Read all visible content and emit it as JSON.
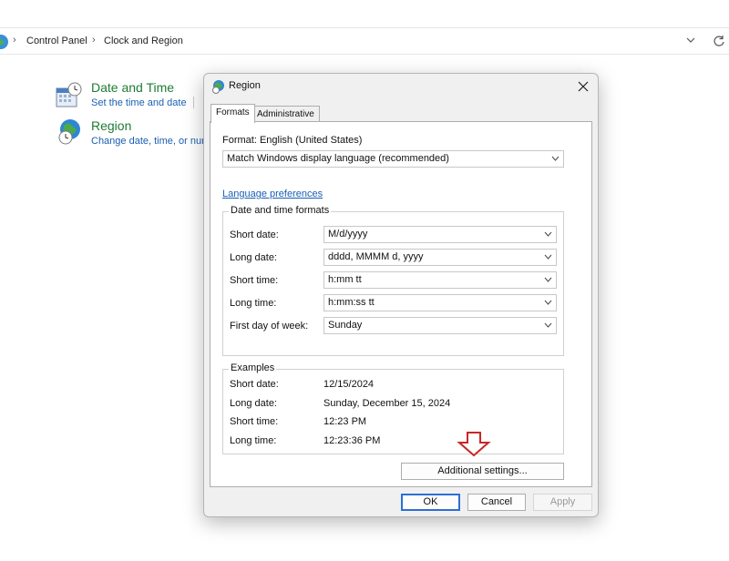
{
  "explorer": {
    "breadcrumb": [
      "Control Panel",
      "Clock and Region"
    ]
  },
  "control_panel": {
    "items": [
      {
        "title": "Date and Time",
        "link": "Set the time and date",
        "icon": "calendar-clock-icon"
      },
      {
        "title": "Region",
        "link": "Change date, time, or nun",
        "icon": "globe-clock-icon"
      }
    ]
  },
  "dialog": {
    "title": "Region",
    "tabs": [
      "Formats",
      "Administrative"
    ],
    "format_label": "Format: English (United States)",
    "format_value": "Match Windows display language (recommended)",
    "language_link": "Language preferences",
    "date_time_group": {
      "legend": "Date and time formats",
      "rows": [
        {
          "label": "Short date:",
          "value": "M/d/yyyy"
        },
        {
          "label": "Long date:",
          "value": "dddd, MMMM d, yyyy"
        },
        {
          "label": "Short time:",
          "value": "h:mm tt"
        },
        {
          "label": "Long time:",
          "value": "h:mm:ss tt"
        },
        {
          "label": "First day of week:",
          "value": "Sunday"
        }
      ]
    },
    "examples_group": {
      "legend": "Examples",
      "rows": [
        {
          "label": "Short date:",
          "value": "12/15/2024"
        },
        {
          "label": "Long date:",
          "value": "Sunday, December 15, 2024"
        },
        {
          "label": "Short time:",
          "value": "12:23 PM"
        },
        {
          "label": "Long time:",
          "value": "12:23:36 PM"
        }
      ]
    },
    "additional_settings": "Additional settings...",
    "buttons": {
      "ok": "OK",
      "cancel": "Cancel",
      "apply": "Apply"
    }
  },
  "colors": {
    "link": "#1a5fb4",
    "cp_title": "#1e7b34",
    "annotation_arrow": "#c62828",
    "primary_border": "#2b6fd6"
  }
}
